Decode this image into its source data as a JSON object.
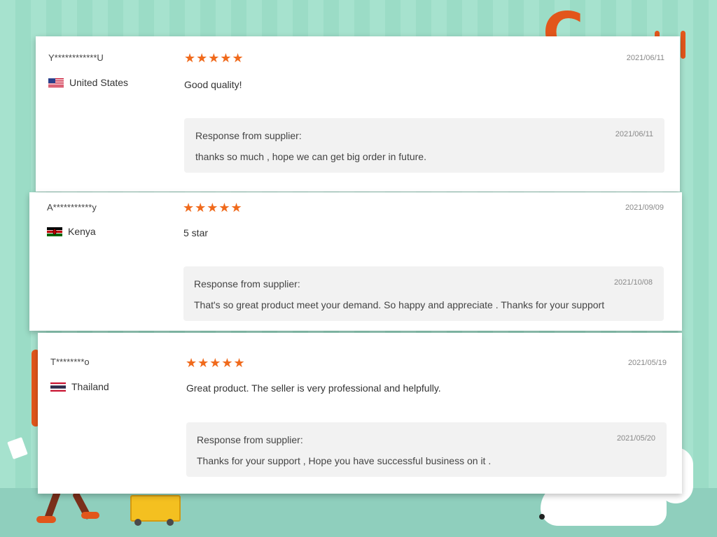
{
  "reviews": [
    {
      "username": "Y************U",
      "country": "United States",
      "flag_icon": "us-flag-icon",
      "rating": 5,
      "stars": "★★★★★",
      "date": "2021/06/11",
      "comment": "Good quality!",
      "response_label": "Response from supplier:",
      "response_date": "2021/06/11",
      "response_text": "thanks so much , hope we can get big order in future."
    },
    {
      "username": "A***********y",
      "country": "Kenya",
      "flag_icon": "kenya-flag-icon",
      "rating": 5,
      "stars": "★★★★★",
      "date": "2021/09/09",
      "comment": "5 star",
      "response_label": "Response from supplier:",
      "response_date": "2021/10/08",
      "response_text": "That's so great product meet your demand. So happy and appreciate . Thanks for your support"
    },
    {
      "username": "T********o",
      "country": "Thailand",
      "flag_icon": "thailand-flag-icon",
      "rating": 5,
      "stars": "★★★★★",
      "date": "2021/05/19",
      "comment": "Great product. The seller is very professional and helpfully.",
      "response_label": "Response from supplier:",
      "response_date": "2021/05/20",
      "response_text": "Thanks for your support , Hope you have successful business on it ."
    }
  ],
  "colors": {
    "star": "#f06a1c",
    "background": "#a3e0cc",
    "accent": "#e2561b"
  }
}
